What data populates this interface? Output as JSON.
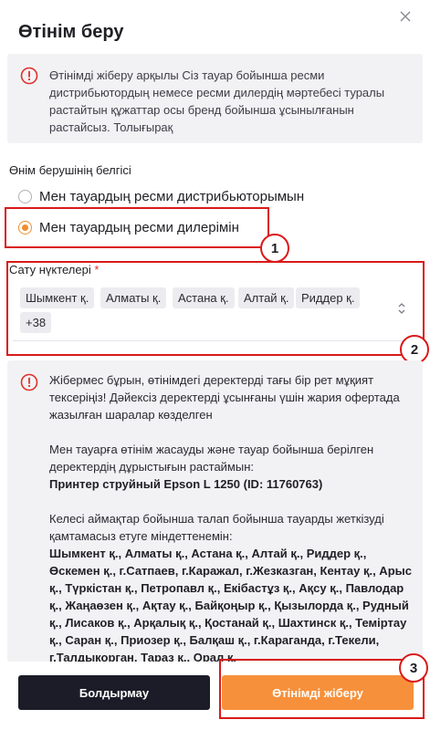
{
  "modal": {
    "title": "Өтінім беру",
    "close_icon": "close-icon"
  },
  "info": {
    "icon": "warning-circle-icon",
    "text": "Өтінімді жіберу арқылы Сіз тауар бойынша ресми дистрибьютордың немесе ресми дилердің мәртебесі туралы растайтын құжаттар осы бренд бойынша ұсынылғанын растайсыз.",
    "more_link": "Толығырақ"
  },
  "provider": {
    "label": "Өнім берушінің белгісі",
    "options": [
      {
        "label": "Мен тауардың ресми дистрибьюторымын",
        "checked": false
      },
      {
        "label": "Мен тауардың ресми дилерімін",
        "checked": true
      }
    ]
  },
  "points": {
    "label": "Сату нүктелері",
    "required_mark": "*",
    "chips": [
      "Шымкент қ.",
      "Алматы қ.",
      "Астана қ.",
      "Алтай қ.",
      "Риддер қ.",
      "+38"
    ],
    "arrow_icon": "updown-chevron-icon"
  },
  "notice": {
    "icon": "warning-circle-icon",
    "p1": "Жібермес бұрын, өтінімдегі деректерді тағы бір рет мұқият тексеріңіз! Дәйексіз деректерді ұсынғаны үшін жария офертада жазылған шаралар көзделген",
    "p2": "Мен тауарға өтінім жасауды және тауар бойынша берілген деректердің дұрыстығын растаймын:",
    "product": "Принтер струйный Epson L 1250 (ID: 11760763)",
    "p3": "Келесі аймақтар бойынша талап бойынша тауарды жеткізуді қамтамасыз етуге міндеттенемін:",
    "regions": "Шымкент қ., Алматы қ., Астана қ., Алтай қ., Риддер қ., Өскемен қ., г.Сатпаев, г.Каражал, г.Жезказган, Кентау қ., Арыс қ., Түркістан қ., Петропавл қ., Екібастұз қ., Ақсу қ., Павлодар қ., Жаңаөзен қ., Ақтау қ., Байқоңыр қ., Қызылорда қ., Рудный қ., Лисаков қ., Арқалық қ., Қостанай қ., Шахтинск қ., Теміртау қ., Саран қ., Приозер қ., Балқаш қ., г.Караганда, г.Текели, г.Талдыкорган, Тараз қ., Орал қ."
  },
  "buttons": {
    "cancel": "Болдырмау",
    "submit": "Өтінімді жіберу"
  },
  "annotations": [
    "1",
    "2",
    "3"
  ],
  "colors": {
    "accent": "#f7903a",
    "dark_button": "#1c1c28",
    "highlight": "#d91a1a",
    "warning": "#e0312b"
  }
}
